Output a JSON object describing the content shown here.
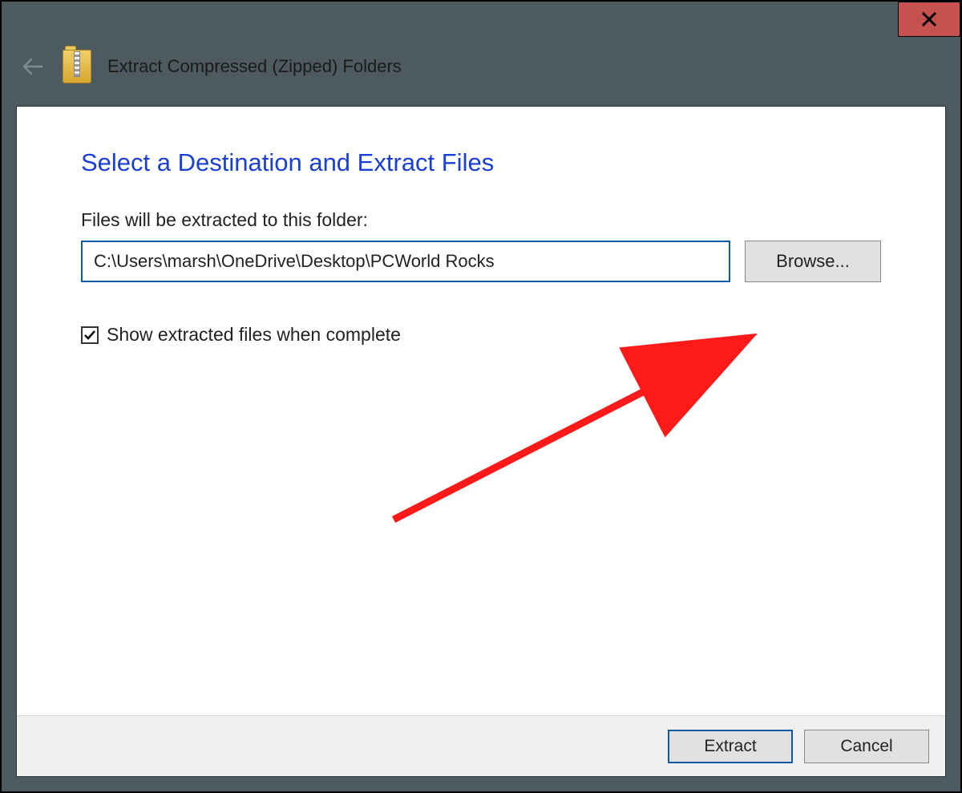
{
  "window": {
    "title": "Extract Compressed (Zipped) Folders"
  },
  "heading": "Select a Destination and Extract Files",
  "path_label": "Files will be extracted to this folder:",
  "path_value": "C:\\Users\\marsh\\OneDrive\\Desktop\\PCWorld Rocks",
  "browse_label": "Browse...",
  "checkbox": {
    "label": "Show extracted files when complete",
    "checked": true
  },
  "footer": {
    "extract": "Extract",
    "cancel": "Cancel"
  }
}
